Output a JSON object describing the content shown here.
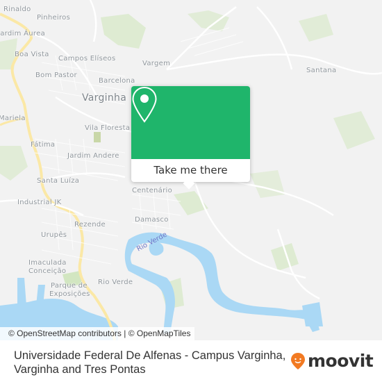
{
  "map": {
    "places": [
      {
        "name": "Rinaldo",
        "type": "suburb"
      },
      {
        "name": "Pinheiros",
        "type": "suburb"
      },
      {
        "name": "Jardim Áurea",
        "type": "suburb"
      },
      {
        "name": "Boa Vista",
        "type": "suburb"
      },
      {
        "name": "Campos Elíseos",
        "type": "suburb"
      },
      {
        "name": "Vargem",
        "type": "suburb"
      },
      {
        "name": "Santana",
        "type": "suburb"
      },
      {
        "name": "Bom Pastor",
        "type": "suburb"
      },
      {
        "name": "Barcelona",
        "type": "suburb"
      },
      {
        "name": "Varginha",
        "type": "city"
      },
      {
        "name": "Mariela",
        "type": "suburb"
      },
      {
        "name": "Vila Floresta",
        "type": "suburb"
      },
      {
        "name": "Fátima",
        "type": "suburb"
      },
      {
        "name": "Jardim Andere",
        "type": "suburb"
      },
      {
        "name": "Santa Luíza",
        "type": "suburb"
      },
      {
        "name": "Industrial JK",
        "type": "suburb"
      },
      {
        "name": "Centenário",
        "type": "suburb"
      },
      {
        "name": "Damasco",
        "type": "suburb"
      },
      {
        "name": "Rezende",
        "type": "suburb"
      },
      {
        "name": "Urupês",
        "type": "suburb"
      },
      {
        "name": "Imaculada",
        "type": "suburb"
      },
      {
        "name": "Conceição",
        "type": "suburb"
      },
      {
        "name": "Parque de",
        "type": "suburb"
      },
      {
        "name": "Exposições",
        "type": "suburb"
      },
      {
        "name": "Rio Verde",
        "type": "suburb"
      }
    ],
    "river_label": "Rio Verde",
    "attribution": "© OpenStreetMap contributors | © OpenMapTiles",
    "colors": {
      "land": "#f2f2f2",
      "water": "#aad8f5",
      "park": "#d5e8c4",
      "highway": "#fbe8a6",
      "road": "#ffffff"
    }
  },
  "popup": {
    "icon": "map-pin-icon",
    "action_label": "Take me there",
    "accent_color": "#1fb56b"
  },
  "footer": {
    "title": "Universidade Federal De Alfenas - Campus Varginha, Varginha and Tres Pontas",
    "logo_text": "moovit",
    "logo_icon": "moovit-pin-icon",
    "logo_color": "#f27a22"
  }
}
